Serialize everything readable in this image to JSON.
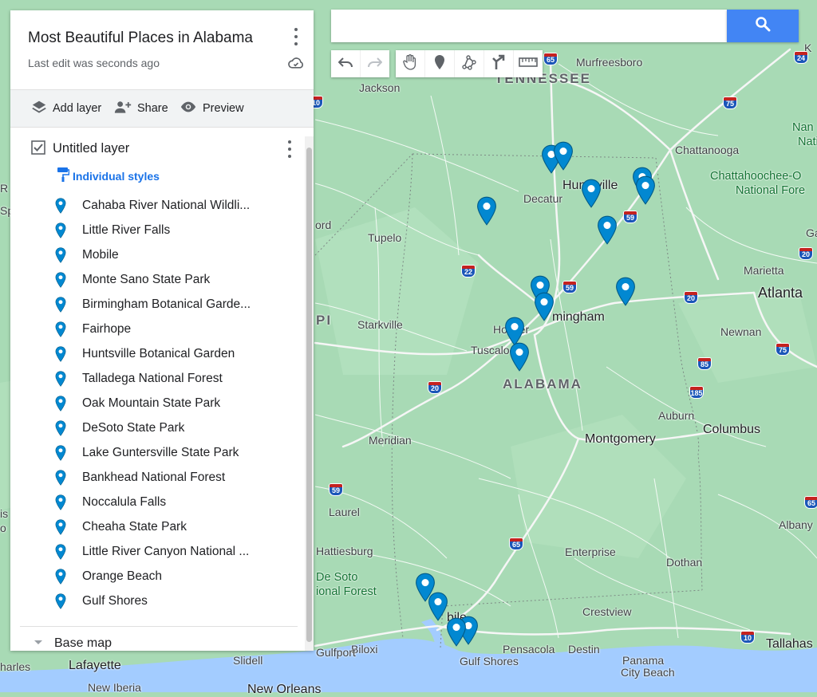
{
  "map_name": "Most Beautiful Places in Alabama",
  "last_edit": "Last edit was seconds ago",
  "actions": {
    "add_layer": "Add layer",
    "share": "Share",
    "preview": "Preview"
  },
  "layer": {
    "name": "Untitled layer",
    "style": "Individual styles",
    "items": [
      "Cahaba River National Wildli...",
      "Little River Falls",
      "Mobile",
      "Monte Sano State Park",
      "Birmingham Botanical Garde...",
      "Fairhope",
      "Huntsville Botanical Garden",
      "Talladega National Forest",
      "Oak Mountain State Park",
      "DeSoto State Park",
      "Lake Guntersville State Park",
      "Bankhead National Forest",
      "Noccalula Falls",
      "Cheaha State Park",
      "Little River Canyon National ...",
      "Orange Beach",
      "Gulf Shores"
    ]
  },
  "base_map": "Base map",
  "search": {
    "value": "",
    "placeholder": ""
  },
  "colors": {
    "marker": "#0288d1",
    "accent": "#1a73e8",
    "search_button": "#4285f4",
    "land": "#a8dab5",
    "water": "#a3ccff"
  },
  "icons": [
    "more-vert-icon",
    "cloud-check-icon",
    "layers-icon",
    "person-add-icon",
    "eye-icon",
    "checkbox-icon",
    "paint-roller-icon",
    "marker-icon",
    "search-icon",
    "undo-icon",
    "redo-icon",
    "hand-icon",
    "add-marker-icon",
    "draw-line-icon",
    "directions-icon",
    "ruler-icon"
  ],
  "map_labels": {
    "murfreesboro": "Murfreesboro",
    "tennessee": "TENNESSEE",
    "jackson": "Jackson",
    "knoxville_k": "K",
    "chattanooga": "Chattanooga",
    "nan": "Nan",
    "natio": "Natio",
    "chattahoochee": "Chattahoochee-O",
    "national_fore": "National Fore",
    "huntsville": "Huntsville",
    "decatur": "Decatur",
    "tupelo": "Tupelo",
    "ord": "ord",
    "marietta": "Marietta",
    "atlanta": "Atlanta",
    "newnan": "Newnan",
    "ga": "Ga",
    "starkville": "Starkville",
    "pi": "PI",
    "hoover": "Hoover",
    "birmingham": "mingham",
    "tuscaloosa": "Tuscaloosa",
    "alabama": "ALABAMA",
    "auburn": "Auburn",
    "columbus": "Columbus",
    "meridian": "Meridian",
    "montgomery": "Montgomery",
    "laurel": "Laurel",
    "hattiesburg": "Hattiesburg",
    "enterprise": "Enterprise",
    "dothan": "Dothan",
    "albany": "Albany",
    "desoto1": "De Soto",
    "desoto2": "ional Forest",
    "mobile": "bile",
    "crestview": "Crestview",
    "biloxi": "Biloxi",
    "gulfport": "Gulfport",
    "pensacola": "Pensacola",
    "destin": "Destin",
    "gulf_shores": "Gulf Shores",
    "panama1": "Panama",
    "panama2": "City Beach",
    "tallahassee": "Tallahas",
    "slidell": "Slidell",
    "lafayette": "Lafayette",
    "charles": "harles",
    "new_iberia": "New Iberia",
    "new_orleans": "New Orleans",
    "edge_r": "R",
    "edge_sp": "Sp",
    "edge_is": "is",
    "edge_no": "o"
  },
  "shields": {
    "i65": "65",
    "i24": "24",
    "i75a": "75",
    "i59a": "59",
    "i22": "22",
    "i59b": "59",
    "i20a": "20",
    "i20b": "20",
    "i20c": "20",
    "i85": "85",
    "i185": "185",
    "i75b": "75",
    "i59c": "59",
    "i65b": "65",
    "i10a": "10",
    "i10b": "10",
    "i65c": "65"
  }
}
